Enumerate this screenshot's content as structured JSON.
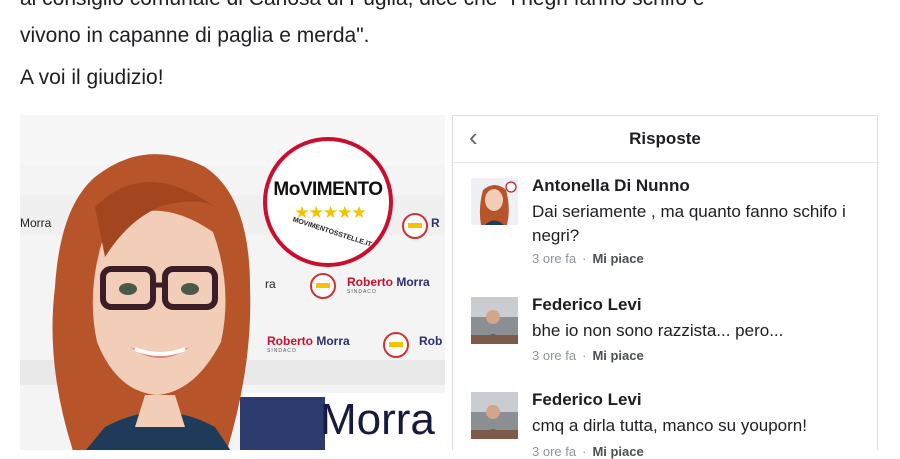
{
  "post": {
    "line1_partial": "al consiglio comunale di Canosa di Puglia, dice che \"i negri fanno schifo e",
    "line2": "vivono in capanne di paglia e merda\".",
    "line3": "A voi il giudizio!"
  },
  "banner": {
    "logo_word": "MoVIMENTO",
    "logo_stars": "★★★★★",
    "logo_url": "MOVIMENTOSSTELLE.IT",
    "candidate_first": "Roberto",
    "candidate_last": "Morra",
    "candidate_role": "SINDACO",
    "partial_left": "Morra",
    "partial_mid": "ra",
    "partial_right": "Rob",
    "partial_r": "R",
    "big_name": "Morra"
  },
  "replies_panel": {
    "back_icon": "chevron-left-icon",
    "title": "Risposte",
    "comments": [
      {
        "name": "Antonella Di Nunno",
        "text": "Dai seriamente , ma quanto fanno schifo i negri?",
        "time": "3 ore fa",
        "like": "Mi piace"
      },
      {
        "name": "Federico Levi",
        "text": "bhe io non sono razzista... pero...",
        "time": "3 ore fa",
        "like": "Mi piace"
      },
      {
        "name": "Federico Levi",
        "text": "cmq a dirla tutta, manco su youporn!",
        "time": "3 ore fa",
        "like": "Mi piace"
      }
    ]
  },
  "colors": {
    "text_primary": "#1c1e21",
    "meta_gray": "#8d949e",
    "m5s_red": "#c8102e",
    "m5s_yellow": "#f3c200",
    "navy": "#2c3a6e"
  }
}
